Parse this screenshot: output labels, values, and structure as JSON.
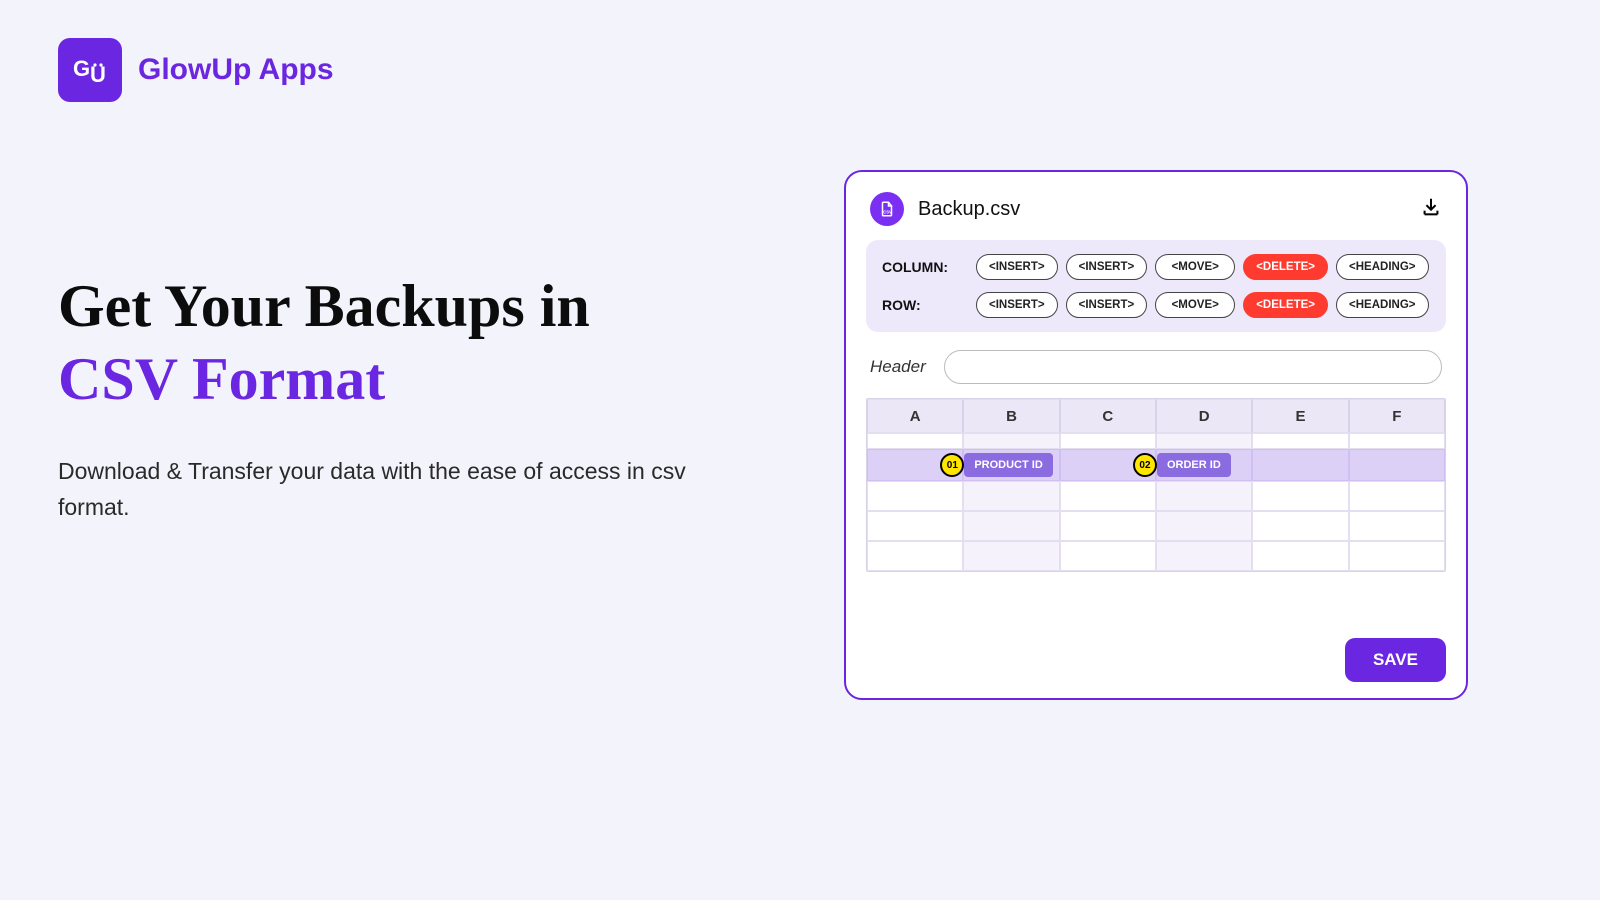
{
  "brand": {
    "logo_initials": "GU",
    "name": "GlowUp Apps"
  },
  "hero": {
    "title_plain": "Get Your Backups in ",
    "title_accent": "CSV Format",
    "subtitle": "Download & Transfer your data with the ease of access in csv format."
  },
  "editor": {
    "file_name": "Backup.csv",
    "csv_badge": "CSV",
    "toolbar": {
      "column_label": "COLUMN:",
      "row_label": "ROW:",
      "column_buttons": [
        "<INSERT>",
        "<INSERT>",
        "<MOVE>",
        "<DELETE>",
        "<HEADING>"
      ],
      "row_buttons": [
        "<INSERT>",
        "<INSERT>",
        "<MOVE>",
        "<DELETE>",
        "<HEADING>"
      ]
    },
    "header_field": {
      "label": "Header",
      "value": ""
    },
    "spreadsheet": {
      "columns": [
        "A",
        "B",
        "C",
        "D",
        "E",
        "F"
      ],
      "tags": [
        {
          "num": "01",
          "label": "PRODUCT ID",
          "col_index": 1
        },
        {
          "num": "02",
          "label": "ORDER ID",
          "col_index": 3
        }
      ]
    },
    "save_label": "SAVE"
  },
  "colors": {
    "accent": "#6a26e1",
    "danger": "#ff3b30",
    "highlight": "#ffe400"
  }
}
